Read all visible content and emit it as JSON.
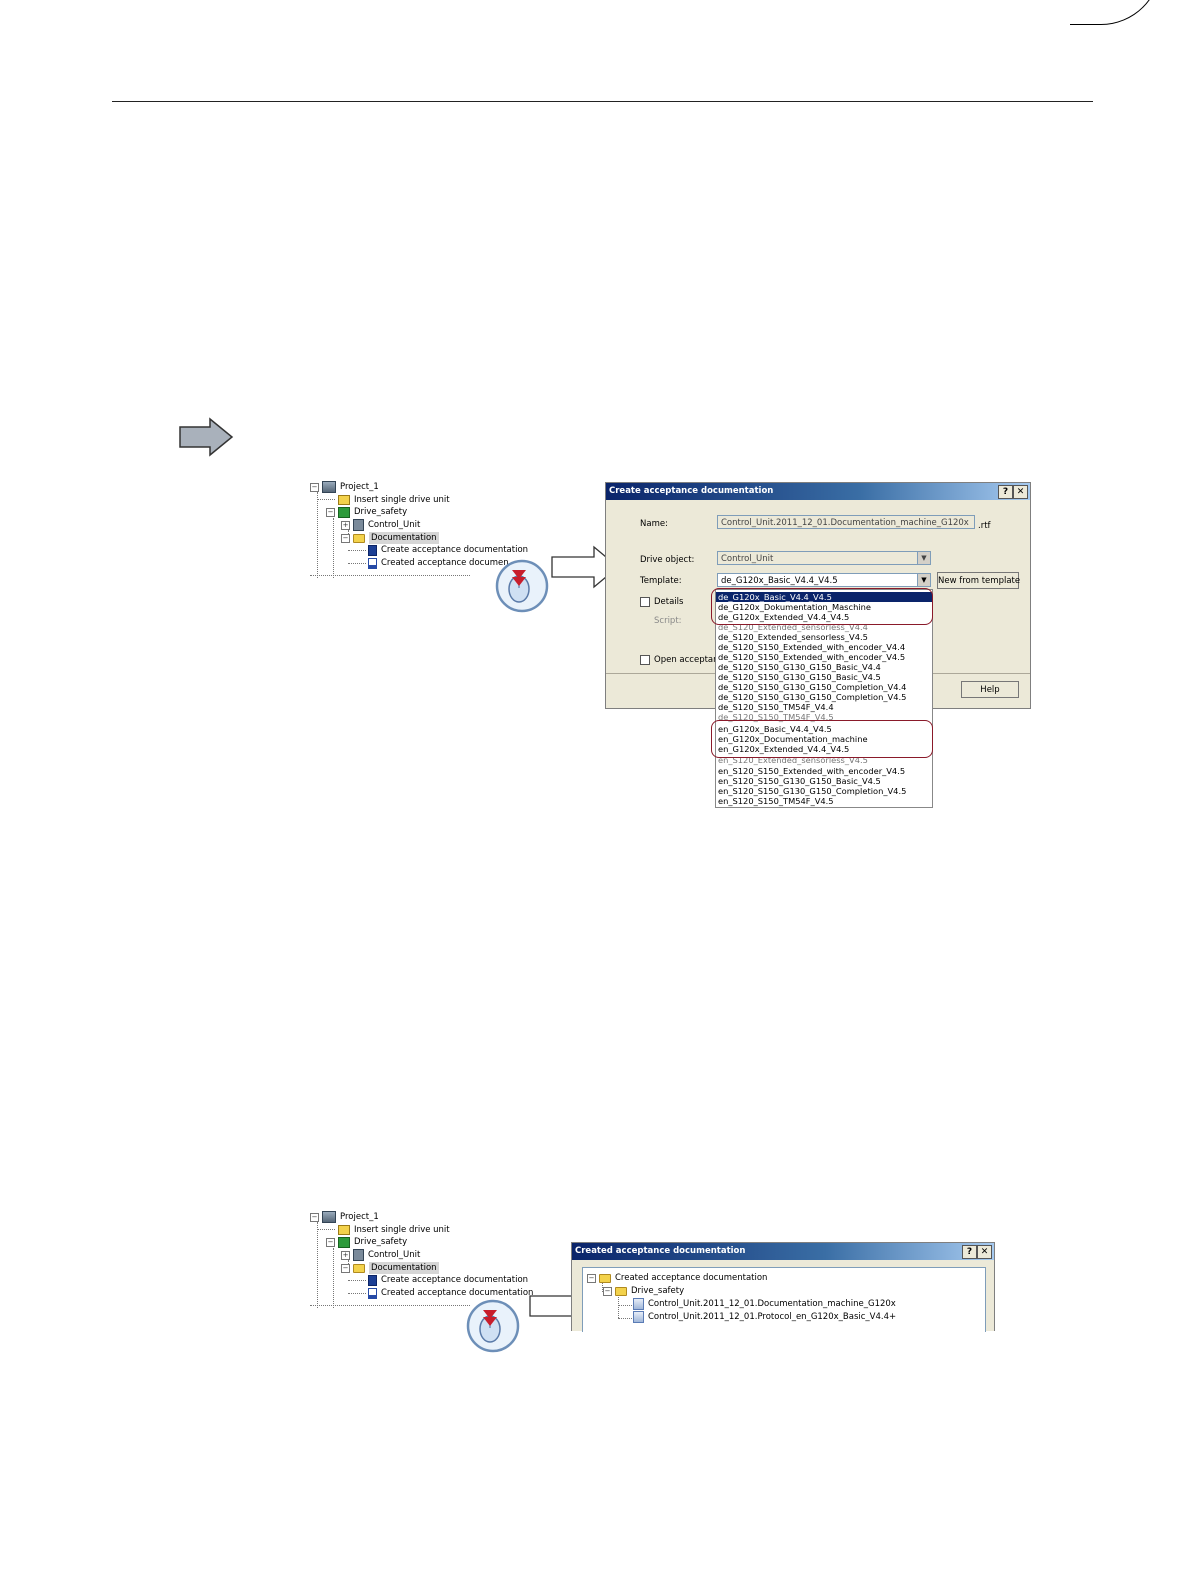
{
  "colors": {
    "title_bar": "#0a246a",
    "dialog_bg": "#ece9d8",
    "highlight_ring": "#8a1a2a",
    "arrow_fill": "#a9b1bb"
  },
  "tree": {
    "project": "Project_1",
    "insert_drive": "Insert single drive unit",
    "drive": "Drive_safety",
    "control_unit": "Control_Unit",
    "documentation": "Documentation",
    "create_doc": "Create acceptance documentation",
    "created_doc_clipped": "Created acceptance documen",
    "created_doc": "Created acceptance documentation"
  },
  "create_dialog": {
    "title": "Create acceptance documentation",
    "help_glyph": "?",
    "close_glyph": "✕",
    "name_label": "Name:",
    "name_value": "Control_Unit.2011_12_01.Documentation_machine_G120x",
    "name_ext": ".rtf",
    "drive_object_label": "Drive object:",
    "drive_object_value": "Control_Unit",
    "template_label": "Template:",
    "template_value": "de_G120x_Basic_V4.4_V4.5",
    "new_from_template": "New from template",
    "details_label": "Details",
    "script_label": "Script:",
    "open_label": "Open acceptanc",
    "help_button": "Help",
    "template_options": [
      "de_G120x_Basic_V4.4_V4.5",
      "de_G120x_Dokumentation_Maschine",
      "de_G120x_Extended_V4.4_V4.5",
      "de_S120_Extended_sensorless_V4.4",
      "de_S120_Extended_sensorless_V4.5",
      "de_S120_S150_Extended_with_encoder_V4.4",
      "de_S120_S150_Extended_with_encoder_V4.5",
      "de_S120_S150_G130_G150_Basic_V4.4",
      "de_S120_S150_G130_G150_Basic_V4.5",
      "de_S120_S150_G130_G150_Completion_V4.4",
      "de_S120_S150_G130_G150_Completion_V4.5",
      "de_S120_S150_TM54F_V4.4",
      "de_S120_S150_TM54F_V4.5",
      "en_G120x_Basic_V4.4_V4.5",
      "en_G120x_Documentation_machine",
      "en_G120x_Extended_V4.4_V4.5",
      "en_S120_Extended_sensorless_V4.5",
      "en_S120_S150_Extended_with_encoder_V4.5",
      "en_S120_S150_G130_G150_Basic_V4.5",
      "en_S120_S150_G130_G150_Completion_V4.5",
      "en_S120_S150_TM54F_V4.5"
    ]
  },
  "created_dialog": {
    "title": "Created acceptance documentation",
    "help_glyph": "?",
    "close_glyph": "✕",
    "root": "Created acceptance documentation",
    "folder": "Drive_safety",
    "files": [
      "Control_Unit.2011_12_01.Documentation_machine_G120x",
      "Control_Unit.2011_12_01.Protocol_en_G120x_Basic_V4.4+"
    ]
  }
}
